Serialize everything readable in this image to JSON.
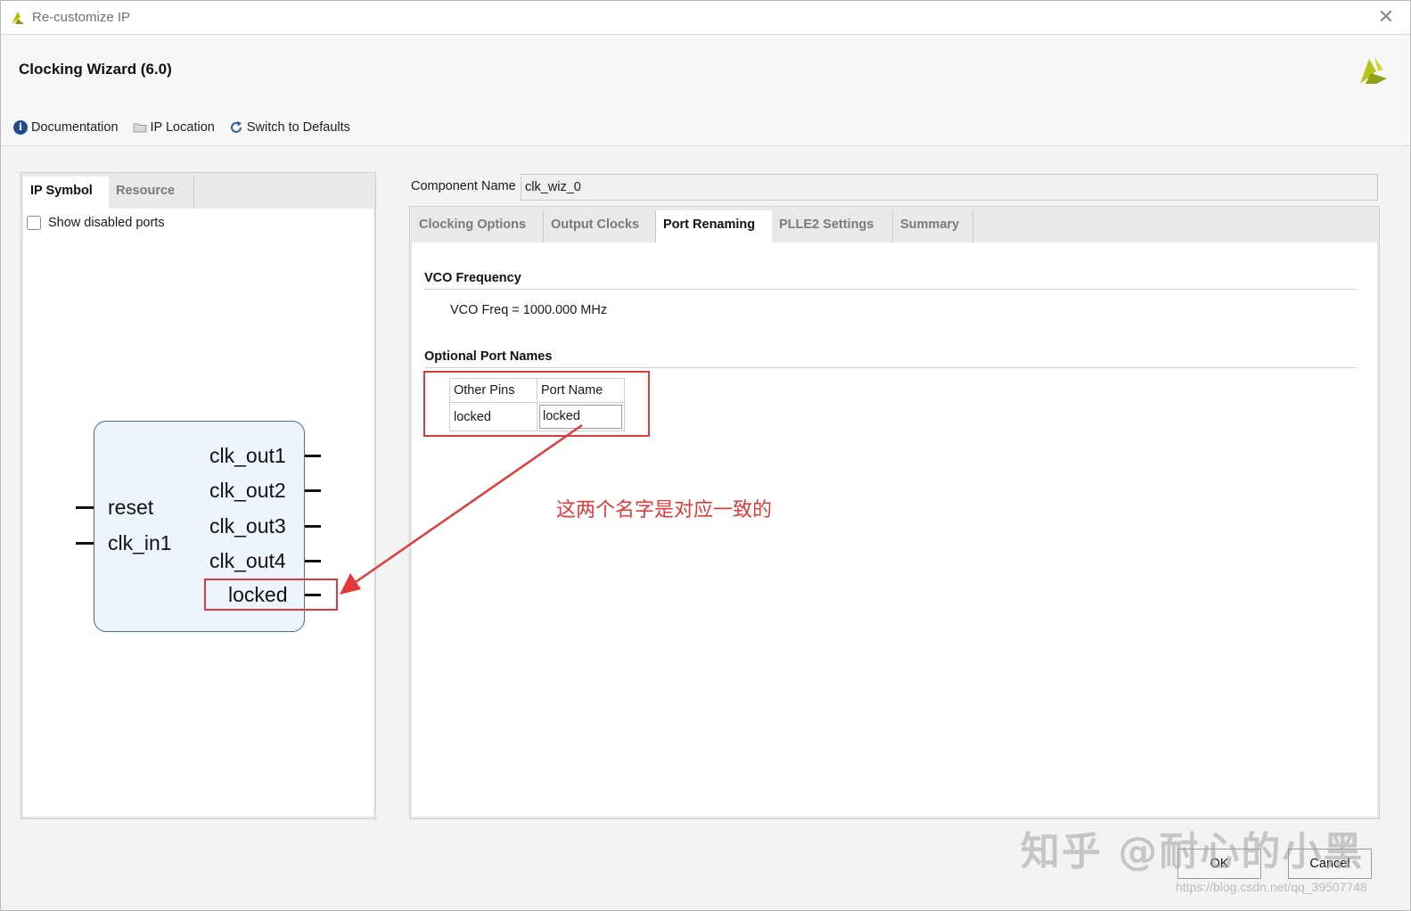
{
  "window": {
    "title": "Re-customize IP",
    "close_glyph": "✕"
  },
  "header": {
    "wizard_title": "Clocking Wizard (6.0)",
    "toolbar": {
      "documentation": "Documentation",
      "ip_location": "IP Location",
      "switch_defaults": "Switch to Defaults"
    }
  },
  "left_panel": {
    "tabs": [
      "IP Symbol",
      "Resource"
    ],
    "show_disabled_ports": "Show disabled ports",
    "symbol": {
      "inputs": [
        "reset",
        "clk_in1"
      ],
      "outputs": [
        "clk_out1",
        "clk_out2",
        "clk_out3",
        "clk_out4",
        "locked"
      ]
    }
  },
  "right_panel": {
    "component_name_label": "Component Name",
    "component_name_value": "clk_wiz_0",
    "tabs": [
      "Clocking Options",
      "Output Clocks",
      "Port Renaming",
      "PLLE2 Settings",
      "Summary"
    ],
    "active_tab": "Port Renaming",
    "vco_section_title": "VCO Frequency",
    "vco_text": "VCO Freq = 1000.000 MHz",
    "optional_section_title": "Optional Port Names",
    "port_table": {
      "headers": [
        "Other Pins",
        "Port Name"
      ],
      "rows": [
        [
          "locked",
          "locked"
        ]
      ]
    }
  },
  "annotation": "这两个名字是对应一致的",
  "buttons": {
    "ok": "OK",
    "cancel": "Cancel"
  },
  "watermark": {
    "text": "知乎 @耐心的小黑",
    "url": "https://blog.csdn.net/qq_39507748"
  },
  "colors": {
    "annotation_red": "#e03a3a",
    "symbol_fill": "#eef4fb",
    "symbol_border": "#4a6a9a",
    "xilinx_logo": "#a8b820"
  }
}
